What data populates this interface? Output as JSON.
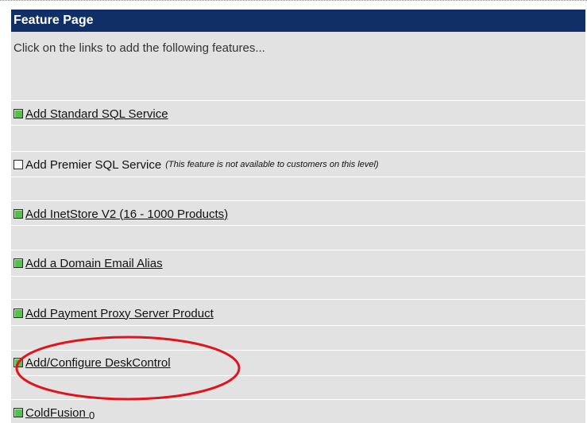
{
  "header": {
    "title": "Feature Page"
  },
  "intro": {
    "text": "Click on the links to add the following features..."
  },
  "features": [
    {
      "label": " Add Standard SQL Service",
      "enabled": true
    },
    {
      "label": " Add Premier SQL Service",
      "enabled": false,
      "note": "(This feature is not available to customers on this level)"
    },
    {
      "label": " Add InetStore V2 (16 - 1000 Products)",
      "enabled": true
    },
    {
      "label": " Add a Domain Email Alias",
      "enabled": true
    },
    {
      "label": " Add Payment Proxy Server Product",
      "enabled": true
    },
    {
      "label": " Add/Configure DeskControl",
      "enabled": true,
      "highlighted": true
    },
    {
      "label": " ColdFusion",
      "enabled": true,
      "suffix": "0"
    }
  ],
  "colors": {
    "header_bg": "#0f2f66",
    "panel_bg": "#e2e2e2",
    "enabled_box": "#53c24c",
    "highlight_circle": "#e0141c"
  },
  "icons": {
    "enabled": "green-checkbox-icon",
    "disabled": "empty-checkbox-icon"
  }
}
